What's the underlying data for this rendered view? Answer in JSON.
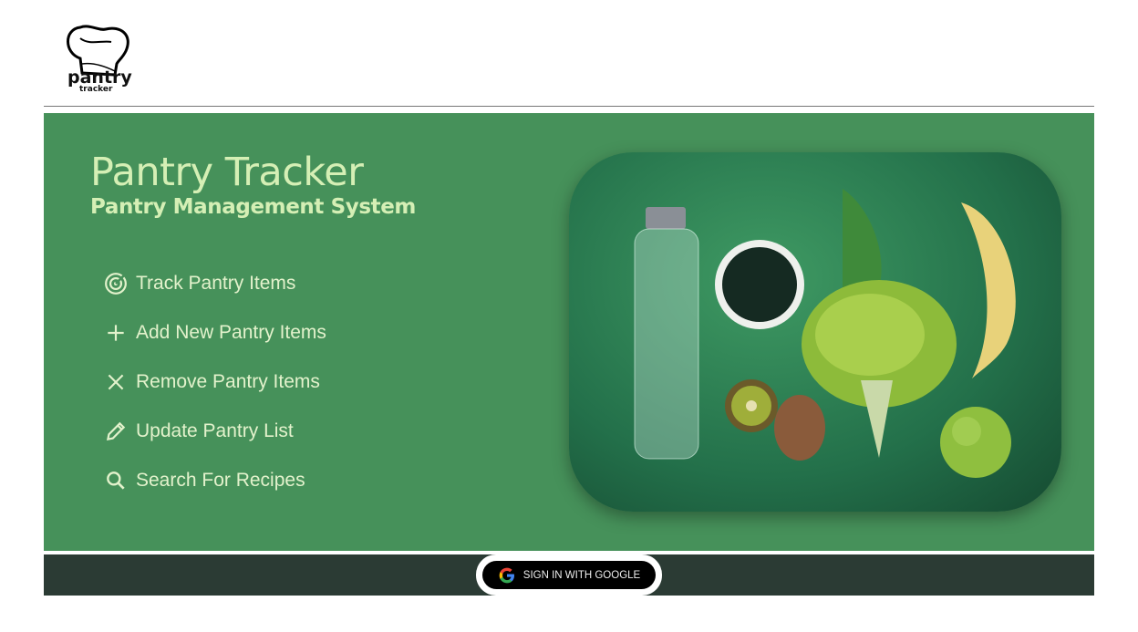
{
  "logo": {
    "text": "pantry",
    "subtext": "tracker",
    "icon": "chef-hat-icon"
  },
  "hero": {
    "title": "Pantry Tracker",
    "subtitle": "Pantry Management System",
    "features": [
      {
        "icon": "track-icon",
        "label": "Track Pantry Items"
      },
      {
        "icon": "plus-icon",
        "label": "Add New Pantry Items"
      },
      {
        "icon": "close-icon",
        "label": "Remove Pantry Items"
      },
      {
        "icon": "pencil-icon",
        "label": "Update Pantry List"
      },
      {
        "icon": "search-icon",
        "label": "Search For Recipes"
      }
    ]
  },
  "footer": {
    "signin_label": "SIGN IN WITH GOOGLE",
    "signin_icon": "google-icon"
  },
  "colors": {
    "hero_bg": "#46915a",
    "footer_bg": "#2b3b34",
    "accent_text": "#d5efb5"
  }
}
